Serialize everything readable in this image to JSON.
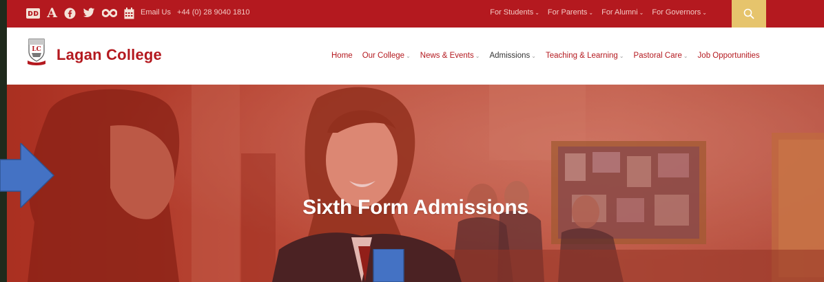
{
  "topbar": {
    "icons": [
      {
        "name": "dyslexia-font-icon",
        "glyph": "ᴅᴅ"
      },
      {
        "name": "text-size-icon",
        "glyph": "A"
      },
      {
        "name": "facebook-icon",
        "glyph": "f"
      },
      {
        "name": "twitter-icon",
        "glyph": "🐦"
      },
      {
        "name": "infinity-icon",
        "glyph": "∞"
      },
      {
        "name": "calendar-icon",
        "glyph": "▦"
      }
    ],
    "email_label": "Email Us",
    "phone": "+44 (0) 28 9040 1810",
    "nav": [
      "For Students",
      "For Parents",
      "For Alumni",
      "For Governors"
    ],
    "search_icon": "search-icon"
  },
  "header": {
    "brand": "Lagan College",
    "nav": [
      {
        "label": "Home",
        "dropdown": false
      },
      {
        "label": "Our College",
        "dropdown": true
      },
      {
        "label": "News & Events",
        "dropdown": true
      },
      {
        "label": "Admissions",
        "dropdown": true,
        "active": true
      },
      {
        "label": "Teaching & Learning",
        "dropdown": true
      },
      {
        "label": "Pastoral Care",
        "dropdown": true
      },
      {
        "label": "Job Opportunities",
        "dropdown": false
      }
    ]
  },
  "hero": {
    "title": "Sixth Form Admissions"
  },
  "colors": {
    "brand_red": "#b4191f",
    "search_gold": "#e6c46c",
    "annotation_blue": "#4472c4"
  }
}
